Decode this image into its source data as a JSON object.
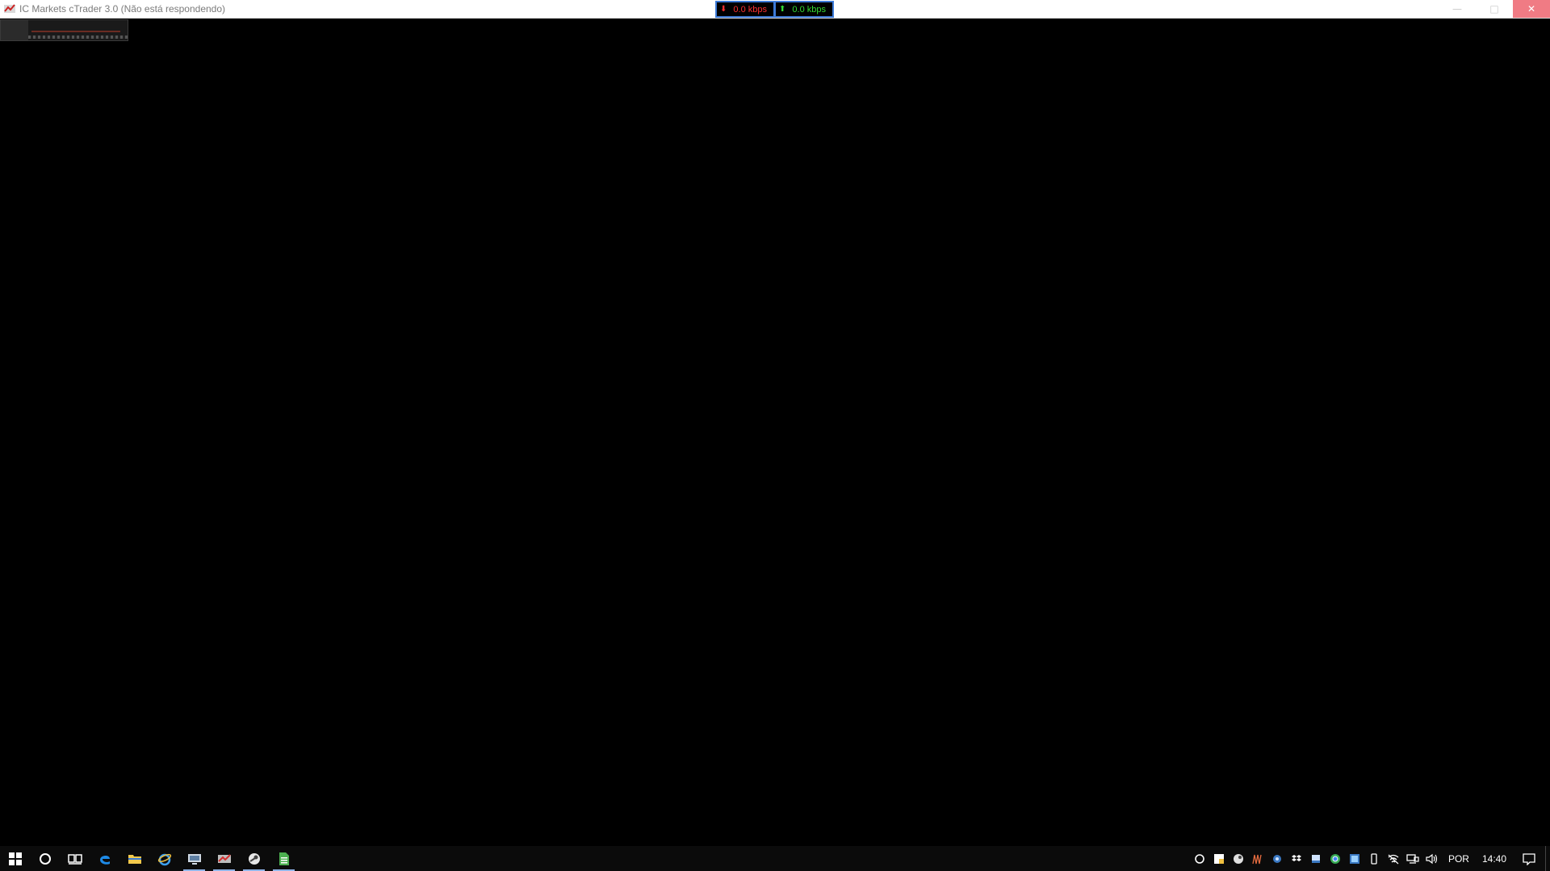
{
  "window": {
    "title": "IC Markets cTrader 3.0 (Não está respondendo)",
    "app_icon": "ctrader-icon",
    "controls": {
      "minimize_icon": "minimize-icon",
      "maximize_icon": "maximize-icon",
      "close_icon": "close-icon"
    }
  },
  "net_meter": {
    "download": "0.0 kbps",
    "upload": "0.0 kbps",
    "download_color": "#ff3030",
    "upload_color": "#33dd33",
    "border_color": "#3d7bd8"
  },
  "taskbar": {
    "apps": [
      {
        "name": "start-icon",
        "active": false
      },
      {
        "name": "search-icon",
        "active": false
      },
      {
        "name": "task-view-icon",
        "active": false
      },
      {
        "name": "edge-icon",
        "active": false
      },
      {
        "name": "file-explorer-icon",
        "active": false
      },
      {
        "name": "internet-explorer-icon",
        "active": false
      },
      {
        "name": "network-monitor-icon",
        "active": true
      },
      {
        "name": "ctrader-icon",
        "active": true
      },
      {
        "name": "steam-icon",
        "active": true
      },
      {
        "name": "spreadsheet-icon",
        "active": true
      }
    ],
    "tray": {
      "icons": [
        "shield-icon",
        "security-icon",
        "steam-icon",
        "network-graph-icon",
        "cloud-icon",
        "dropbox-icon",
        "monitor-icon",
        "chrome-icon",
        "display-icon",
        "usb-icon",
        "wifi-icon",
        "network-icon",
        "volume-icon"
      ],
      "language": "POR",
      "time": "14:40"
    }
  },
  "colors": {
    "background": "#000000",
    "taskbar": "#0b0b0b",
    "titlebar": "#ffffff",
    "close_button": "#f07b84"
  }
}
